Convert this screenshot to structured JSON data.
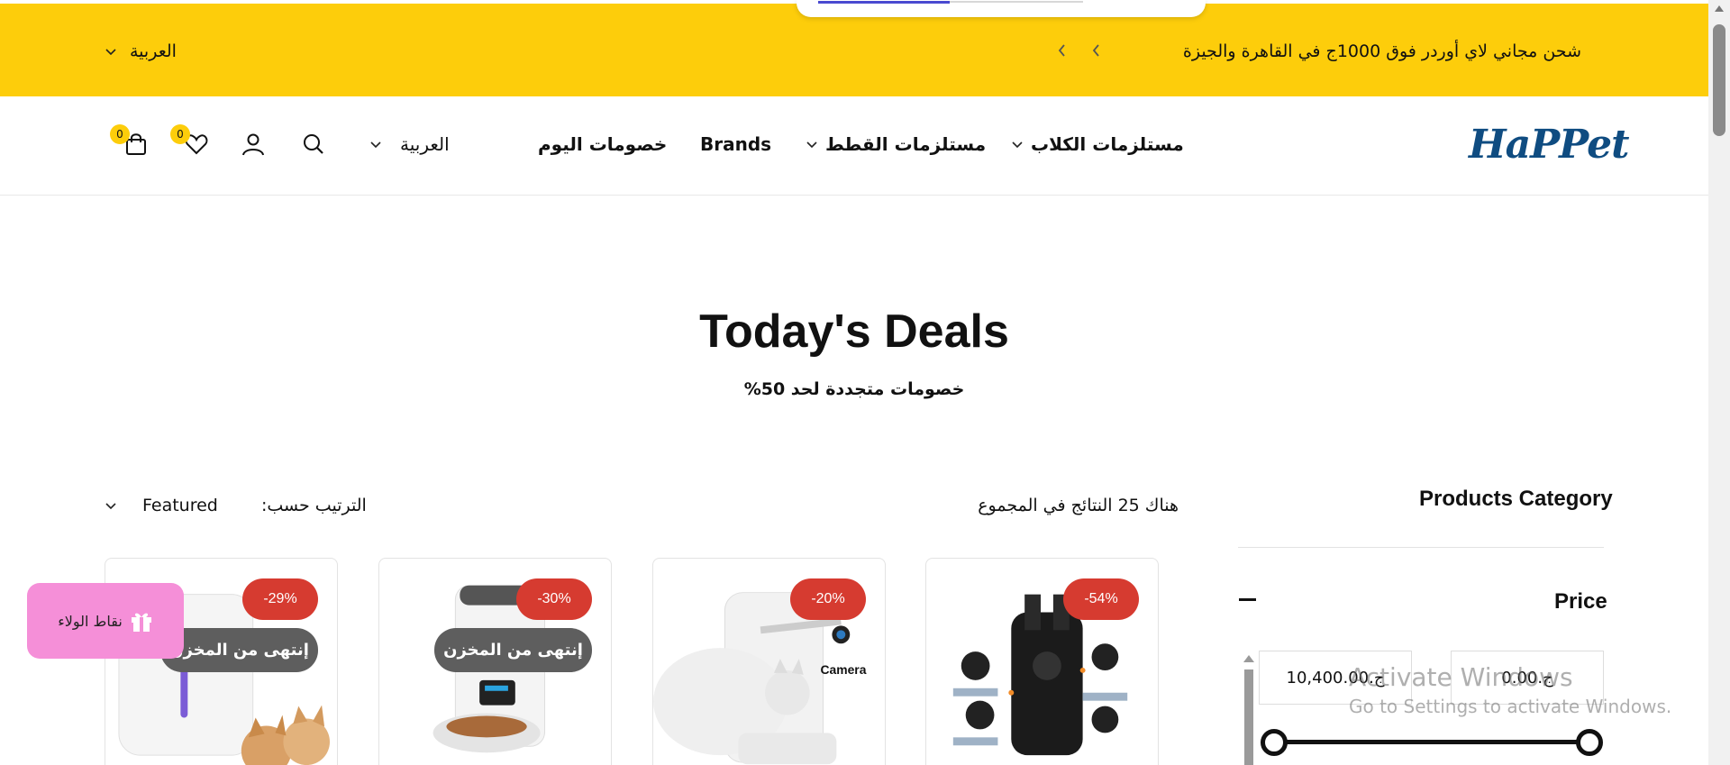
{
  "announcement": {
    "message": "شحن مجاني لاي أوردر فوق 1000ج في القاهرة والجيزة",
    "language": "العربية",
    "background": "#fdcd0b"
  },
  "header": {
    "logo": "HaPPet",
    "nav": {
      "dog_supplies": "مستلزمات الكلاب",
      "cat_supplies": "مستلزمات القطط",
      "brands": "Brands",
      "todays_deals": "خصومات اليوم"
    },
    "language": "العربية",
    "wishlist_count": "0",
    "cart_count": "0"
  },
  "page": {
    "title": "Today's Deals",
    "subtitle": "خصومات متجددة لحد 50%"
  },
  "toolbar": {
    "results_text": "هناك 25 النتائج في المجموع",
    "sort_label": "الترتيب حسب:",
    "sort_value": "Featured"
  },
  "sidebar": {
    "category_title": "Products Category",
    "price_title": "Price",
    "price_min": "0.00.ج",
    "price_max": "10,400.00.ج"
  },
  "products": [
    {
      "discount": "-54%",
      "icon": "pet-carrier-backpack"
    },
    {
      "discount": "-20%",
      "icon": "automatic-feeder-camera",
      "camera_label": "Camera"
    },
    {
      "discount": "-30%",
      "sold_out": "إنتهى من المخزن",
      "icon": "automatic-feeder"
    },
    {
      "discount": "-29%",
      "sold_out": "إنتهى من المخزن",
      "icon": "water-fountain"
    }
  ],
  "loyalty": {
    "label": "نقاط الولاء"
  },
  "watermark": {
    "line1": "Activate Windows",
    "line2": "Go to Settings to activate Windows."
  },
  "colors": {
    "accent": "#fdcd0b",
    "discount": "#d63b30",
    "logo": "#0f4c81",
    "loyalty": "#f58fd8"
  }
}
